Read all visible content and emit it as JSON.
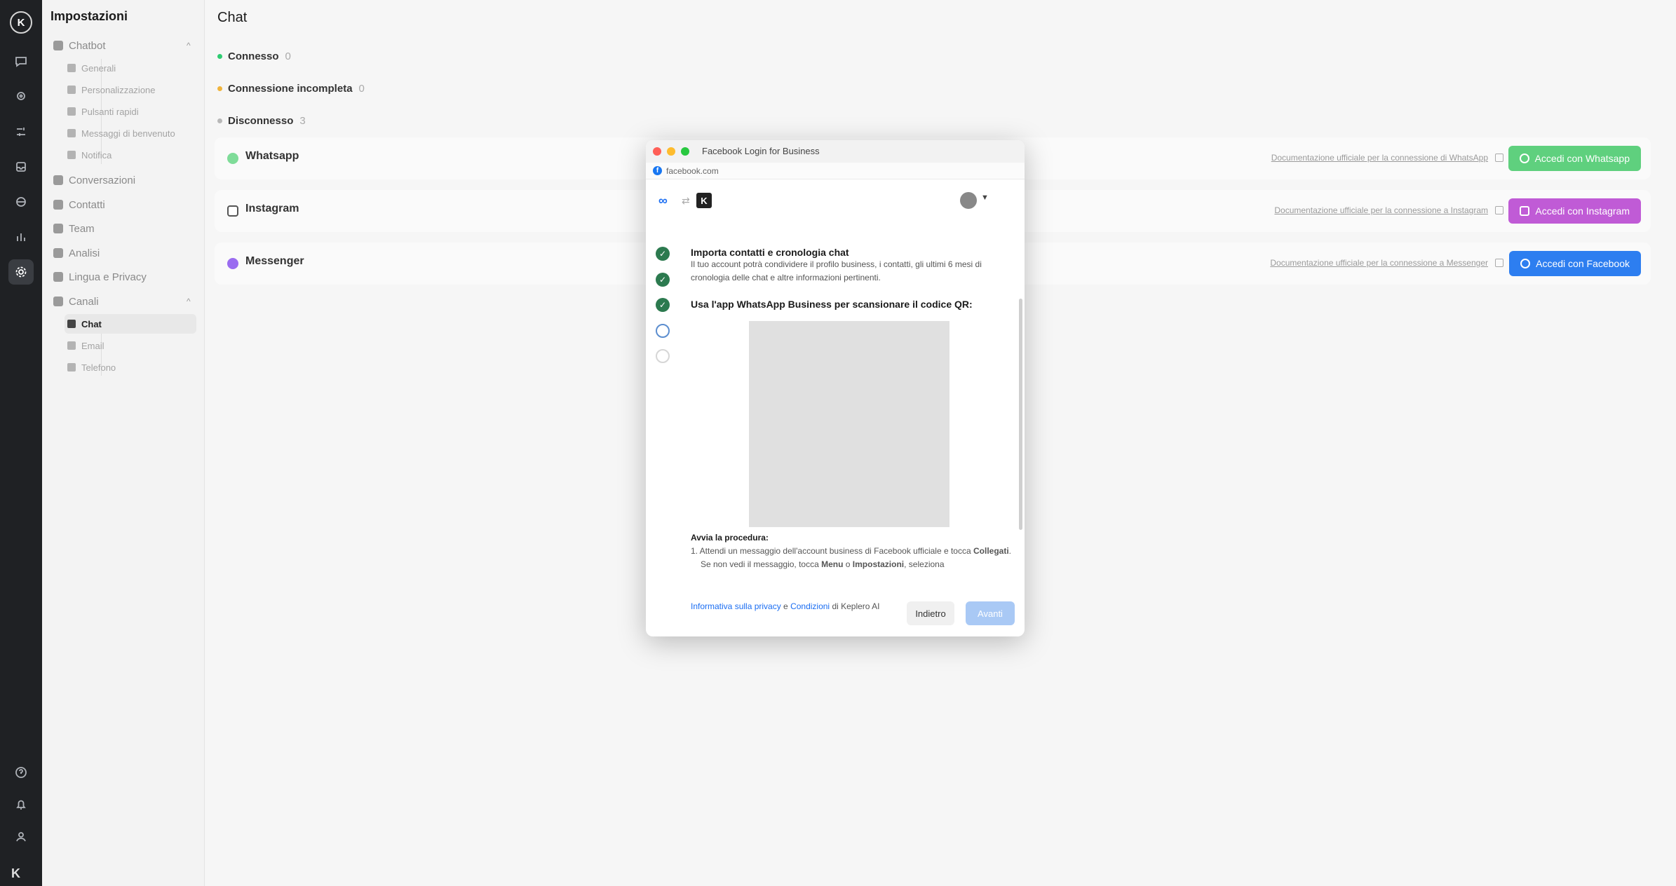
{
  "rail": {
    "logo": "K",
    "items": [
      "chat-icon",
      "location-icon",
      "tools-icon",
      "inbox-icon",
      "globe-icon",
      "chart-icon",
      "gear-icon"
    ],
    "bottom": [
      "help-icon",
      "bell-icon",
      "user-icon"
    ],
    "foot_logo": "K"
  },
  "sidebar": {
    "title": "Impostazioni",
    "chatbot": {
      "label": "Chatbot",
      "children": [
        "Generali",
        "Personalizzazione",
        "Pulsanti rapidi",
        "Messaggi di benvenuto",
        "Notifica"
      ]
    },
    "items": [
      "Conversazioni",
      "Contatti",
      "Team",
      "Analisi",
      "Lingua e Privacy"
    ],
    "canali": {
      "label": "Canali",
      "children": [
        "Chat",
        "Email",
        "Telefono"
      ]
    },
    "chevron": "^"
  },
  "main": {
    "title": "Chat",
    "statuses": [
      {
        "label": "Connesso",
        "count": "0",
        "color": "#2ecc71"
      },
      {
        "label": "Connessione incompleta",
        "count": "0",
        "color": "#f0b43c"
      },
      {
        "label": "Disconnesso",
        "count": "3",
        "color": "#b8b8b8"
      }
    ],
    "channels": [
      {
        "name": "Whatsapp",
        "doc": "Documentazione ufficiale per la connessione di WhatsApp",
        "cta": "Accedi con Whatsapp",
        "color": "#5fd07e",
        "icon": "whatsapp-icon"
      },
      {
        "name": "Instagram",
        "doc": "Documentazione ufficiale per la connessione a Instagram",
        "cta": "Accedi con Instagram",
        "color": "#c05bd6",
        "icon": "instagram-icon"
      },
      {
        "name": "Messenger",
        "doc": "Documentazione ufficiale per la connessione a Messenger",
        "cta": "Accedi con Facebook",
        "color": "#2d7ef0",
        "icon": "messenger-icon"
      }
    ]
  },
  "modal": {
    "window_title": "Facebook Login for Business",
    "url": "facebook.com",
    "meta_logo": "∞",
    "k_logo": "K",
    "section_title": "Importa contatti e cronologia chat",
    "section_text": "Il tuo account potrà condividere il profilo business, i contatti, gli ultimi 6 mesi di cronologia delle chat e altre informazioni pertinenti.",
    "qr_title": "Usa l'app WhatsApp Business per scansionare il codice QR:",
    "procedure_title": "Avvia la procedura:",
    "procedure_step1_a": "1. Attendi un messaggio dell'account business di Facebook ufficiale e tocca ",
    "procedure_step1_b": "Collegati",
    "procedure_step1_c": ".",
    "procedure_step2_a": "Se non vedi il messaggio, tocca ",
    "procedure_step2_b": "Menu",
    "procedure_step2_c": " o ",
    "procedure_step2_d": "Impostazioni",
    "procedure_step2_e": ", seleziona",
    "privacy_link": "Informativa sulla privacy",
    "and": " e ",
    "terms_link": "Condizioni",
    "of_company": " di Keplero AI",
    "back_label": "Indietro",
    "next_label": "Avanti"
  }
}
